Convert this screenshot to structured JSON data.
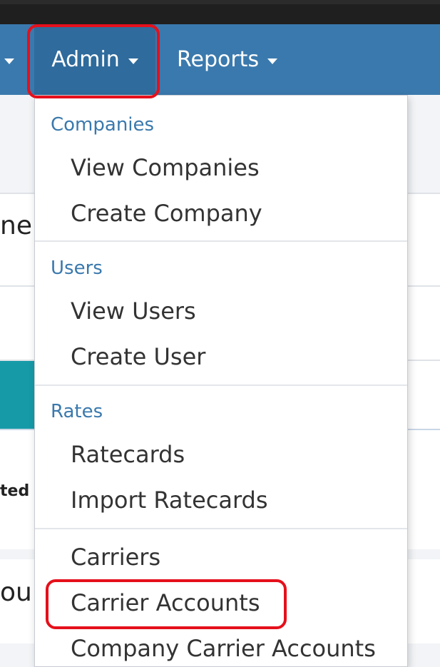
{
  "navbar": {
    "items": [
      {
        "label": "",
        "has_caret": true
      },
      {
        "label": "Admin",
        "has_caret": true
      },
      {
        "label": "Reports",
        "has_caret": true
      }
    ]
  },
  "background": {
    "heading_fragment": "ne",
    "label_fragment": "ted",
    "footer_fragment": "ou"
  },
  "dropdown": {
    "sections": [
      {
        "header": "Companies",
        "items": [
          "View Companies",
          "Create Company"
        ]
      },
      {
        "header": "Users",
        "items": [
          "View Users",
          "Create User"
        ]
      },
      {
        "header": "Rates",
        "items": [
          "Ratecards",
          "Import Ratecards"
        ]
      },
      {
        "header": "",
        "items": [
          "Carriers",
          "Carrier Accounts",
          "Company Carrier Accounts"
        ]
      }
    ]
  },
  "colors": {
    "navbar": "#3a79ad",
    "highlight": "#e5101b",
    "section_header": "#3a79ad"
  }
}
